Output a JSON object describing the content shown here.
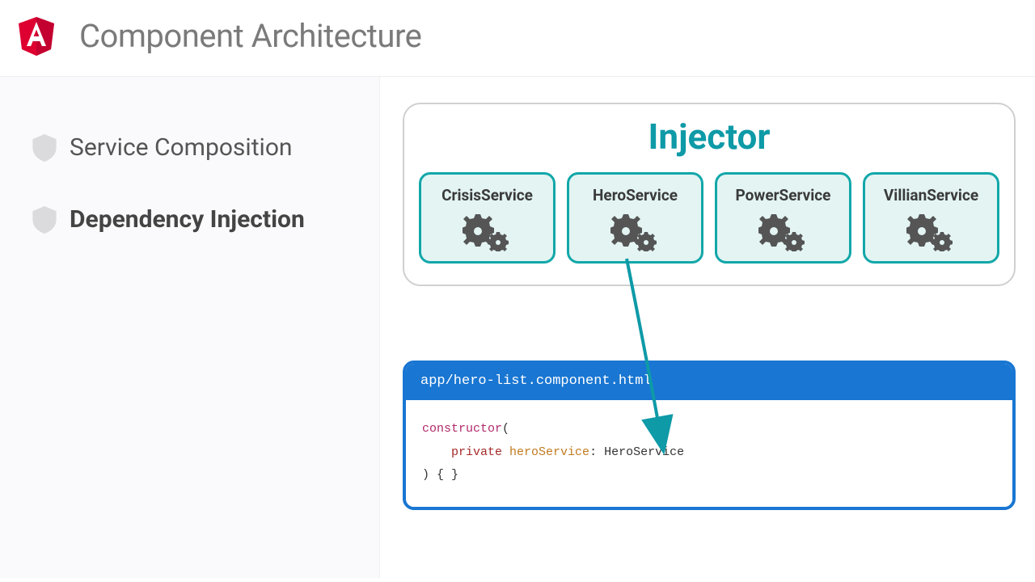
{
  "header": {
    "title": "Component Architecture"
  },
  "sidebar": {
    "items": [
      {
        "label": "Service Composition",
        "active": false
      },
      {
        "label": "Dependency Injection",
        "active": true
      }
    ]
  },
  "injector": {
    "title": "Injector",
    "services": [
      {
        "name": "CrisisService"
      },
      {
        "name": "HeroService"
      },
      {
        "name": "PowerService"
      },
      {
        "name": "VillianService"
      }
    ]
  },
  "code": {
    "filename": "app/hero-list.component.html",
    "lines": {
      "l1_kw": "constructor",
      "l1_rest": "(",
      "l2_access": "private",
      "l2_var": "heroService",
      "l2_rest": ": HeroService",
      "l3": ") { }"
    }
  },
  "colors": {
    "accent_teal": "#0e9aa7",
    "accent_blue": "#1976d2",
    "angular_red": "#dd0031"
  }
}
